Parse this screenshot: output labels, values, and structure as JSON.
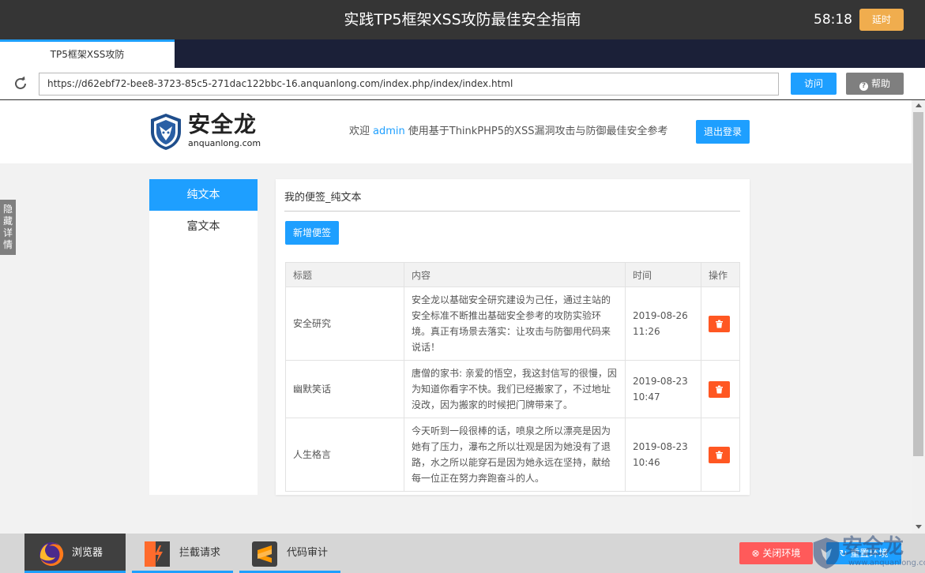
{
  "titlebar": {
    "title": "实践TP5框架XSS攻防最佳安全指南",
    "timer": "58:18",
    "delay_label": "延时"
  },
  "tab": {
    "label": "TP5框架XSS攻防"
  },
  "address": {
    "url": "https://d62ebf72-bee8-3723-85c5-271dac122bbc-16.anquanlong.com/index.php/index/index.html",
    "visit_label": "访问",
    "help_label": "帮助"
  },
  "site": {
    "logo_cn": "安全龙",
    "logo_en": "anquanlong.com",
    "welcome_prefix": "欢迎",
    "username": "admin",
    "welcome_suffix": "使用基于ThinkPHP5的XSS漏洞攻击与防御最佳安全参考",
    "logout_label": "退出登录"
  },
  "menu": {
    "items": [
      {
        "label": "纯文本",
        "active": true
      },
      {
        "label": "富文本",
        "active": false
      }
    ]
  },
  "panel": {
    "title": "我的便签_纯文本",
    "add_label": "新增便签",
    "columns": [
      "标题",
      "内容",
      "时间",
      "操作"
    ],
    "rows": [
      {
        "title": "安全研究",
        "content": "安全龙以基础安全研究建设为己任，通过主站的安全标准不断推出基础安全参考的攻防实验环境。真正有场景去落实：让攻击与防御用代码来说话！",
        "date": "2019-08-26",
        "time": "11:26"
      },
      {
        "title": "幽默笑话",
        "content": "唐僧的家书: 亲爱的悟空，我这封信写的很慢，因为知道你看字不快。我们已经搬家了，不过地址没改，因为搬家的时候把门牌带来了。",
        "date": "2019-08-23",
        "time": "10:47"
      },
      {
        "title": "人生格言",
        "content": "今天听到一段很棒的话，喷泉之所以漂亮是因为她有了压力，瀑布之所以壮观是因为她没有了退路，水之所以能穿石是因为她永远在坚持，献给每一位正在努力奔跑奋斗的人。",
        "date": "2019-08-23",
        "time": "10:46"
      }
    ]
  },
  "sidebar_tab": {
    "chars": [
      "隐",
      "藏",
      "详",
      "情"
    ]
  },
  "dock": {
    "tabs": [
      {
        "label": "浏览器"
      },
      {
        "label": "拦截请求"
      },
      {
        "label": "代码审计"
      }
    ],
    "close_label": "关闭环境",
    "reset_label": "重置环境",
    "watermark_cn": "安全龙",
    "watermark_en": "www.anquanlong.com"
  },
  "colors": {
    "primary": "#1e9fff",
    "danger": "#ff5722",
    "warning": "#f0ad4e",
    "titlebar": "#353535",
    "tabbar": "#1b2038"
  }
}
